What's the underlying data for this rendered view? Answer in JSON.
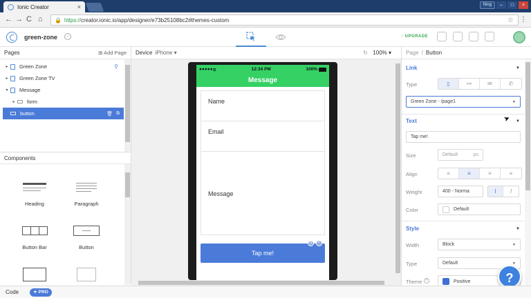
{
  "browser": {
    "tab_title": "Ionic Creator",
    "tab_close": "×",
    "user_label": "Ning",
    "win_min": "–",
    "win_max": "□",
    "win_close": "×",
    "back": "←",
    "forward": "→",
    "reload": "C",
    "home": "⌂",
    "url_https": "https://",
    "url_rest": "creator.ionic.io/app/designer/e73b25108bc2#themes-custom",
    "star": "☆",
    "menu": "⋮"
  },
  "header": {
    "project_name": "green-zone",
    "upgrade_label": "↑ UPGRADE"
  },
  "pages_panel": {
    "title": "Pages",
    "add_label": "Add Page",
    "items": [
      {
        "label": "Green Zone",
        "caret": "▸"
      },
      {
        "label": "Green Zone TV",
        "caret": "▸"
      },
      {
        "label": "Message",
        "caret": "▾"
      },
      {
        "label": "form",
        "caret": "▸"
      },
      {
        "label": "button",
        "caret": ""
      }
    ]
  },
  "components_panel": {
    "title": "Components",
    "items": [
      "Heading",
      "Paragraph",
      "Button Bar",
      "Button"
    ]
  },
  "canvas": {
    "device_label": "Device",
    "device_value": "iPhone ▾",
    "zoom": "100% ▾",
    "status_carrier": "●●●●● ",
    "status_time": "12:34 PM",
    "status_battery": "100%",
    "nav_title": "Message",
    "fields": [
      "Name",
      "Email",
      "Message"
    ],
    "button_label": "Tap me!"
  },
  "props": {
    "crumb_parent": "Page",
    "crumb_sep": "/",
    "crumb_current": "Button",
    "link_section": "Link",
    "type_label": "Type",
    "link_target": "Green Zone - /page1",
    "text_section": "Text",
    "text_value": "Tap me!",
    "size_label": "Size",
    "size_value": "Default",
    "size_unit": "px",
    "align_label": "Align",
    "weight_label": "Weight",
    "weight_value": "400 - Norma",
    "color_label": "Color",
    "color_value": "Default",
    "style_section": "Style",
    "width_label": "Width",
    "width_value": "Block",
    "style_type_label": "Type",
    "style_type_value": "Default",
    "theme_label": "Theme",
    "theme_value": "Positive",
    "theme_color": "#3f6fd6"
  },
  "bottom": {
    "code_label": "Code",
    "pro_label": "★ PRO"
  },
  "help_label": "?",
  "colors": {
    "accent": "#4b7bd8",
    "navbar_green": "#35d165",
    "upgrade_green": "#35a852"
  }
}
